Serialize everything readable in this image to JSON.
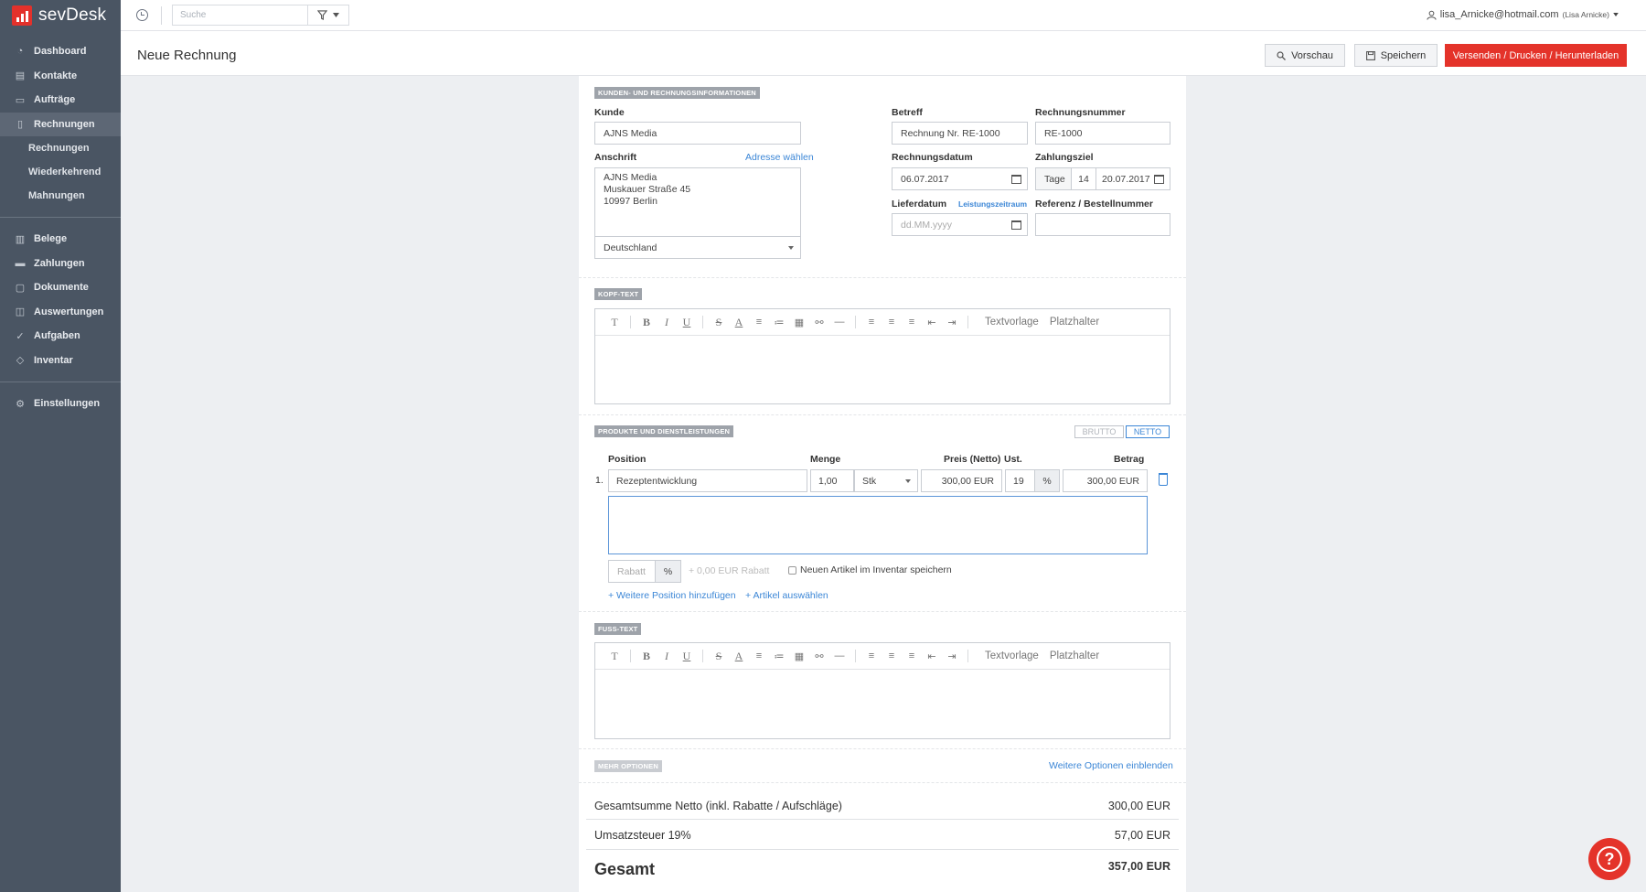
{
  "app": {
    "name": "sevDesk"
  },
  "sidebar": {
    "items": [
      {
        "label": "Dashboard",
        "icon": "dashboard-icon"
      },
      {
        "label": "Kontakte",
        "icon": "contacts-icon"
      },
      {
        "label": "Aufträge",
        "icon": "folder-icon"
      },
      {
        "label": "Rechnungen",
        "icon": "document-icon"
      },
      {
        "label": "Belege",
        "icon": "receipt-icon"
      },
      {
        "label": "Zahlungen",
        "icon": "card-icon"
      },
      {
        "label": "Dokumente",
        "icon": "file-icon"
      },
      {
        "label": "Auswertungen",
        "icon": "chart-icon"
      },
      {
        "label": "Aufgaben",
        "icon": "check-icon"
      },
      {
        "label": "Inventar",
        "icon": "box-icon"
      },
      {
        "label": "Einstellungen",
        "icon": "gear-icon"
      }
    ],
    "subitems": [
      "Rechnungen",
      "Wiederkehrend",
      "Mahnungen"
    ]
  },
  "topbar": {
    "search_placeholder": "Suche",
    "user_email": "lisa_Arnicke@hotmail.com",
    "user_name": "(Lisa Arnicke)"
  },
  "header": {
    "title": "Neue Rechnung",
    "preview_label": "Vorschau",
    "save_label": "Speichern",
    "send_label": "Versenden / Drucken / Herunterladen"
  },
  "customer": {
    "section_title": "KUNDEN- UND RECHNUNGSINFORMATIONEN",
    "kunde_label": "Kunde",
    "kunde_value": "AJNS Media",
    "anschrift_label": "Anschrift",
    "adresse_link": "Adresse wählen",
    "address_lines": [
      "AJNS Media",
      "Muskauer Straße 45",
      "10997 Berlin"
    ],
    "country": "Deutschland",
    "betreff_label": "Betreff",
    "betreff_value": "Rechnung Nr. RE-1000",
    "rechnungsnummer_label": "Rechnungsnummer",
    "rechnungsnummer_value": "RE-1000",
    "rechnungsdatum_label": "Rechnungsdatum",
    "rechnungsdatum_value": "06.07.2017",
    "zahlungsziel_label": "Zahlungsziel",
    "zahlungsziel_unit": "Tage",
    "zahlungsziel_days": "14",
    "zahlungsziel_date": "20.07.2017",
    "lieferdatum_label": "Lieferdatum",
    "leistungszeitraum_link": "Leistungszeitraum",
    "lieferdatum_placeholder": "dd.MM.yyyy",
    "referenz_label": "Referenz / Bestellnummer"
  },
  "editor": {
    "kopf_title": "KOPF-TEXT",
    "fuss_title": "FUSS-TEXT",
    "textvorlage": "Textvorlage",
    "platzhalter": "Platzhalter",
    "glyphs": {
      "format": "T",
      "bold": "B",
      "italic": "I",
      "underline": "U",
      "strike": "S",
      "color": "A",
      "ordered": "≡",
      "bullets": "≔",
      "table": "▦",
      "link": "⚯",
      "rule": "—",
      "left": "≡",
      "center": "≡",
      "right": "≡",
      "outdent": "⇤",
      "indent": "⇥"
    }
  },
  "products": {
    "section_title": "PRODUKTE UND DIENSTLEISTUNGEN",
    "brutto": "BRUTTO",
    "netto": "NETTO",
    "col_position": "Position",
    "col_menge": "Menge",
    "col_preis": "Preis (Netto)",
    "col_ust": "Ust.",
    "col_betrag": "Betrag",
    "row_num": "1.",
    "row_position": "Rezeptentwicklung",
    "row_menge": "1,00",
    "row_unit": "Stk",
    "row_preis": "300,00 EUR",
    "row_ust": "19",
    "row_pct": "%",
    "row_betrag": "300,00 EUR",
    "rabatt_placeholder": "Rabatt",
    "rabatt_pct": "%",
    "rabatt_info": "+ 0,00 EUR Rabatt",
    "save_inventory": "Neuen Artikel im Inventar speichern",
    "add_position": "+ Weitere Position hinzufügen",
    "select_article": "+ Artikel auswählen"
  },
  "options": {
    "title": "MEHR OPTIONEN",
    "link": "Weitere Optionen einblenden"
  },
  "totals": {
    "netto_label": "Gesamtsumme Netto (inkl. Rabatte / Aufschläge)",
    "netto_value": "300,00 EUR",
    "ust_label": "Umsatzsteuer 19%",
    "ust_value": "57,00 EUR",
    "gesamt_label": "Gesamt",
    "gesamt_value": "357,00 EUR"
  },
  "help": {
    "label": "?"
  },
  "colors": {
    "accent": "#e4332a",
    "link": "#3b86d6",
    "sidebar": "#4a5563"
  }
}
